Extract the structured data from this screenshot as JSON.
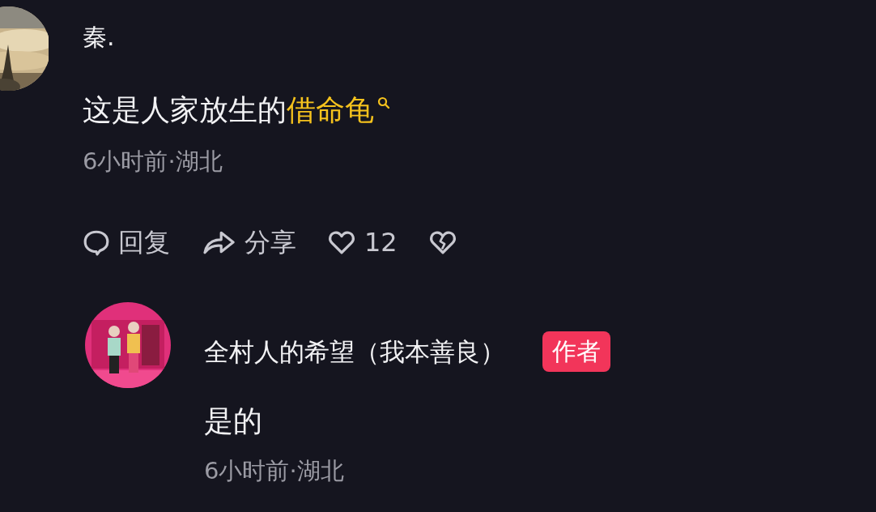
{
  "comment": {
    "author": "秦.",
    "text": "这是人家放生的",
    "search_link": "借命龟",
    "time_location": "6小时前·湖北",
    "actions": [
      {
        "kind": "reply",
        "label": "回复"
      },
      {
        "kind": "share",
        "label": "分享"
      },
      {
        "kind": "like",
        "label": "12"
      },
      {
        "kind": "dislike"
      }
    ]
  },
  "reply": {
    "author": "全村人的希望（我本善良）",
    "badge": "作者",
    "text": "是的",
    "time_location": "6小时前·湖北"
  }
}
